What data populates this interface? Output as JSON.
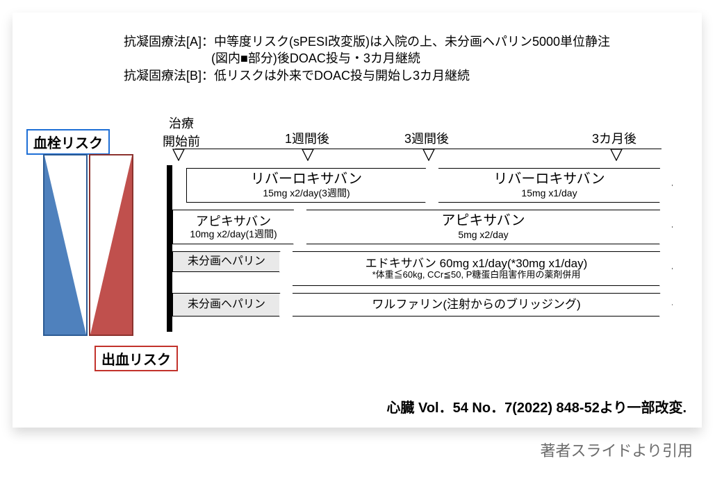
{
  "desc": "抗凝固療法[A]：中等度リスク(sPESI改変版)は入院の上、未分画ヘパリン5000単位静注\n　　　　　　　(図内■部分)後DOAC投与・3カ月継続\n抗凝固療法[B]：低リスクは外来でDOAC投与開始し3カ月継続",
  "labels": {
    "thrombus": "血栓リスク",
    "bleed": "出血リスク"
  },
  "timeline": {
    "start": "治療\n開始前",
    "w1": "1週間後",
    "w3": "3週間後",
    "m3": "3カ月後"
  },
  "rows": {
    "riva1": {
      "name": "リバーロキサバン",
      "dose": "15mg x2/day(3週間)"
    },
    "riva2": {
      "name": "リバーロキサバン",
      "dose": "15mg x1/day"
    },
    "apx1": {
      "name": "アピキサバン",
      "dose": "10mg x2/day(1週間)"
    },
    "apx2": {
      "name": "アピキサバン",
      "dose": "5mg x2/day"
    },
    "hep": "未分画ヘパリン",
    "edo": {
      "name": "エドキサバン 60mg x1/day(*30mg x1/day)",
      "note": "*体重≦60kg, CCr≦50, P糖蛋白阻害作用の薬剤併用"
    },
    "warf": "ワルファリン(注射からのブリッジング)"
  },
  "citation": "心臓 Vol．54 No．7(2022) 848-52より一部改変.",
  "caption": "著者スライドより引用"
}
